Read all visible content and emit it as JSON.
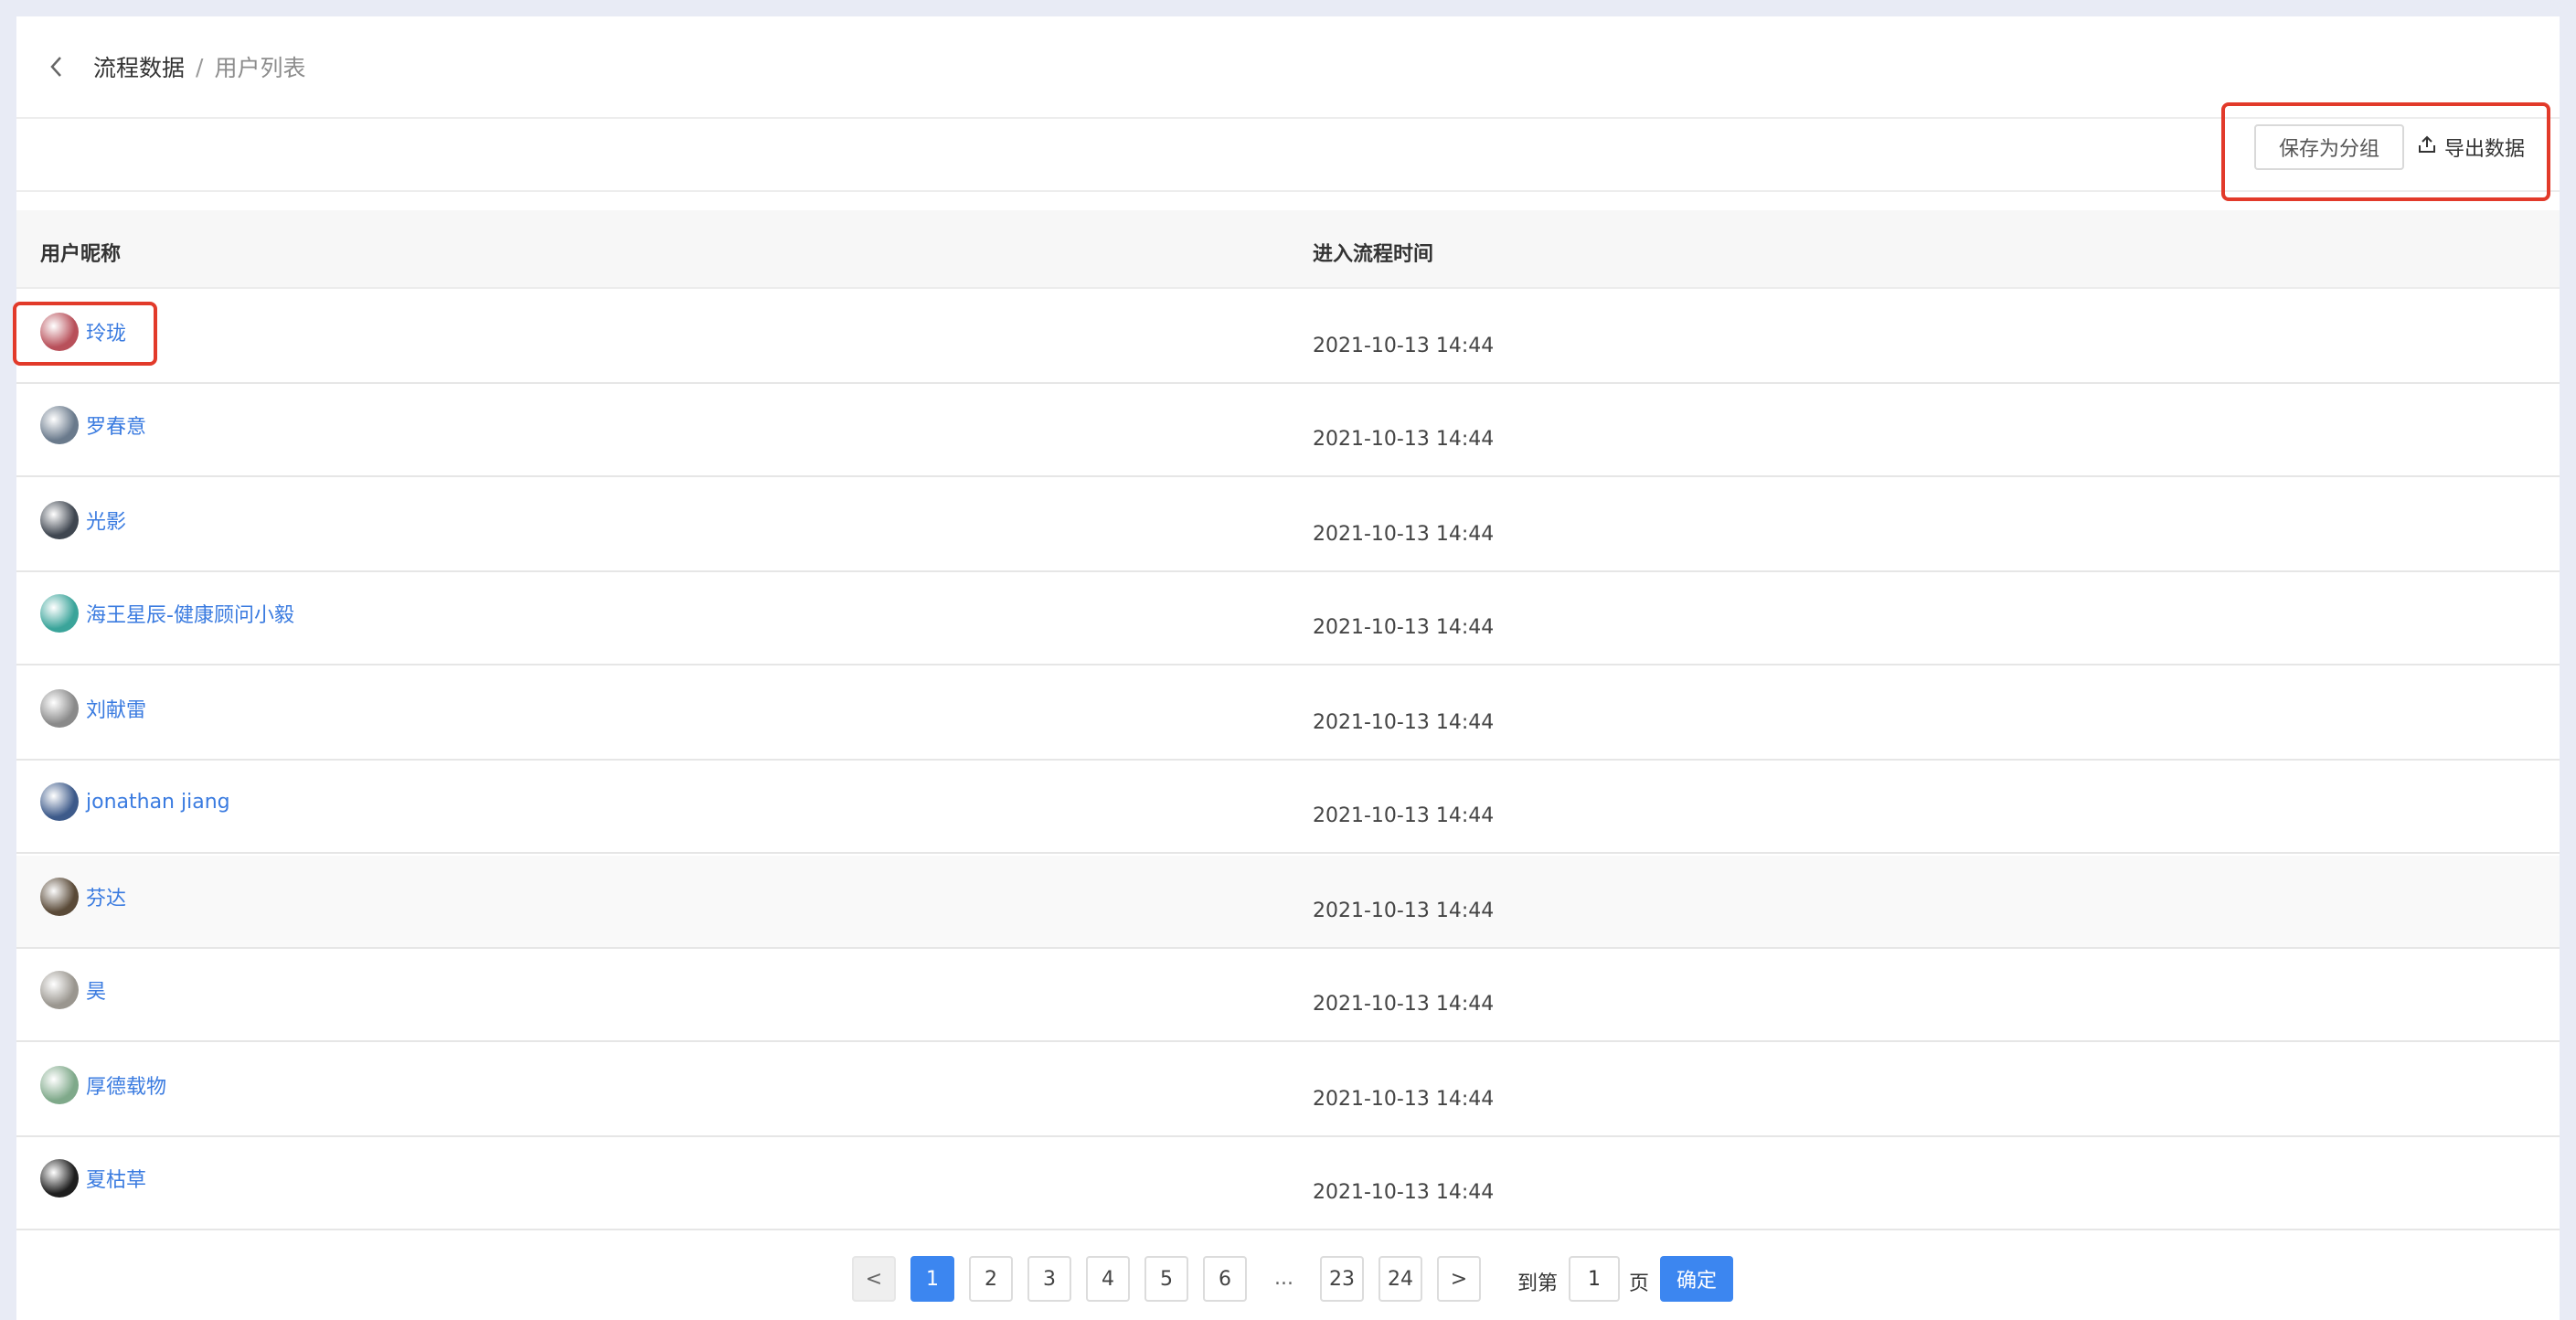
{
  "breadcrumb": {
    "root": "流程数据",
    "separator": "/",
    "current": "用户列表"
  },
  "toolbar": {
    "save_label": "保存为分组",
    "export_label": "导出数据"
  },
  "table": {
    "columns": [
      "用户昵称",
      "进入流程时间"
    ],
    "rows": [
      {
        "name": "玲珑",
        "time": "2021-10-13 14:44",
        "avatar_color": "#b8505a"
      },
      {
        "name": "罗春意",
        "time": "2021-10-13 14:44",
        "avatar_color": "#6a7a8c"
      },
      {
        "name": "光影",
        "time": "2021-10-13 14:44",
        "avatar_color": "#3f4650"
      },
      {
        "name": "海王星辰-健康顾问小毅",
        "time": "2021-10-13 14:44",
        "avatar_color": "#3aa49a"
      },
      {
        "name": "刘献雷",
        "time": "2021-10-13 14:44",
        "avatar_color": "#8a8a8a"
      },
      {
        "name": "jonathan jiang",
        "time": "2021-10-13 14:44",
        "avatar_color": "#3d5a8a"
      },
      {
        "name": "芬达",
        "time": "2021-10-13 14:44",
        "avatar_color": "#5a4a38"
      },
      {
        "name": "昊",
        "time": "2021-10-13 14:44",
        "avatar_color": "#9a968f"
      },
      {
        "name": "厚德载物",
        "time": "2021-10-13 14:44",
        "avatar_color": "#7fa98a"
      },
      {
        "name": "夏枯草",
        "time": "2021-10-13 14:44",
        "avatar_color": "#1e1e1e"
      }
    ]
  },
  "pagination": {
    "prev": "<",
    "next": ">",
    "pages": [
      "1",
      "2",
      "3",
      "4",
      "5",
      "6"
    ],
    "ellipsis": "...",
    "tail_pages": [
      "23",
      "24"
    ],
    "current_page": "1",
    "goto_prefix": "到第",
    "goto_value": "1",
    "goto_suffix": "页",
    "confirm_label": "确定"
  },
  "colors": {
    "accent": "#3c86f0",
    "link": "#3a7be0",
    "highlight": "#e23a2a"
  }
}
